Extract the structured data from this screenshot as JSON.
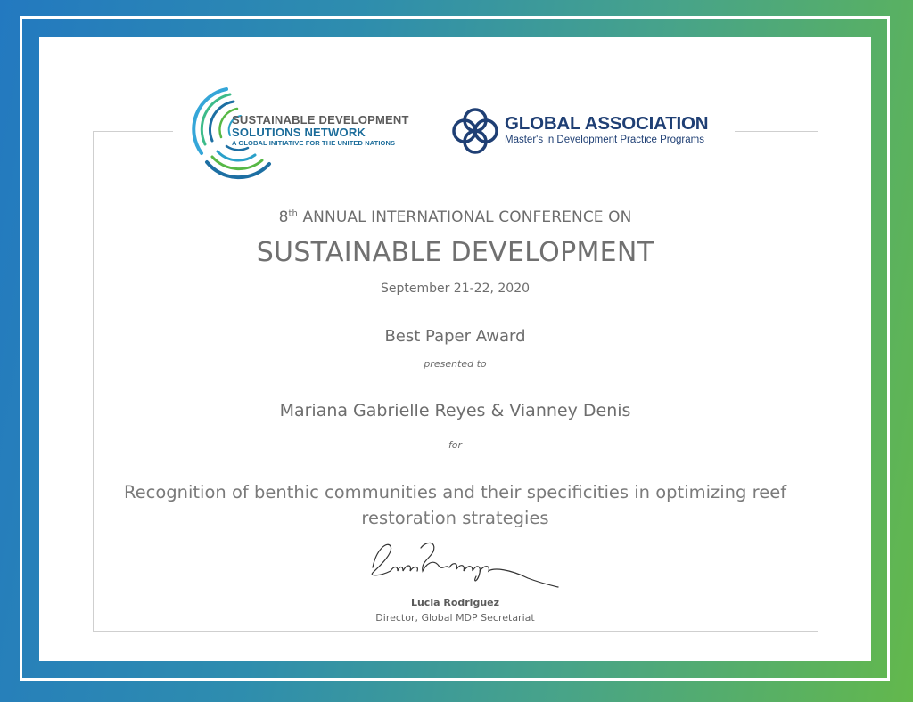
{
  "colors": {
    "frame_start": "#2379c0",
    "frame_end": "#63b84c",
    "sdsn_blue": "#1b6c9a",
    "ga_navy": "#1f3f74",
    "text_gray": "#6d6d6d"
  },
  "logos": {
    "sdsn": {
      "icon": "concentric-rings-logo-icon",
      "line1": "SUSTAINABLE DEVELOPMENT",
      "line2": "SOLUTIONS NETWORK",
      "line3": "A GLOBAL INITIATIVE FOR THE UNITED NATIONS"
    },
    "ga": {
      "icon": "interlocking-circles-logo-icon",
      "line1": "GLOBAL ASSOCIATION",
      "line2": "Master's in Development Practice Programs"
    }
  },
  "conference": {
    "ordinal_num": "8",
    "ordinal_suffix": "th",
    "line1_rest": " ANNUAL INTERNATIONAL CONFERENCE ON",
    "title": "SUSTAINABLE DEVELOPMENT",
    "date": "September 21-22, 2020"
  },
  "award": {
    "name": "Best Paper Award",
    "presented_to": "presented to",
    "recipients": "Mariana Gabrielle Reyes & Vianney Denis",
    "for_label": "for",
    "paper_title": "Recognition of benthic communities and their specificities in optimizing reef restoration strategies"
  },
  "signatory": {
    "name": "Lucia Rodriguez",
    "role": "Director, Global MDP Secretariat"
  }
}
